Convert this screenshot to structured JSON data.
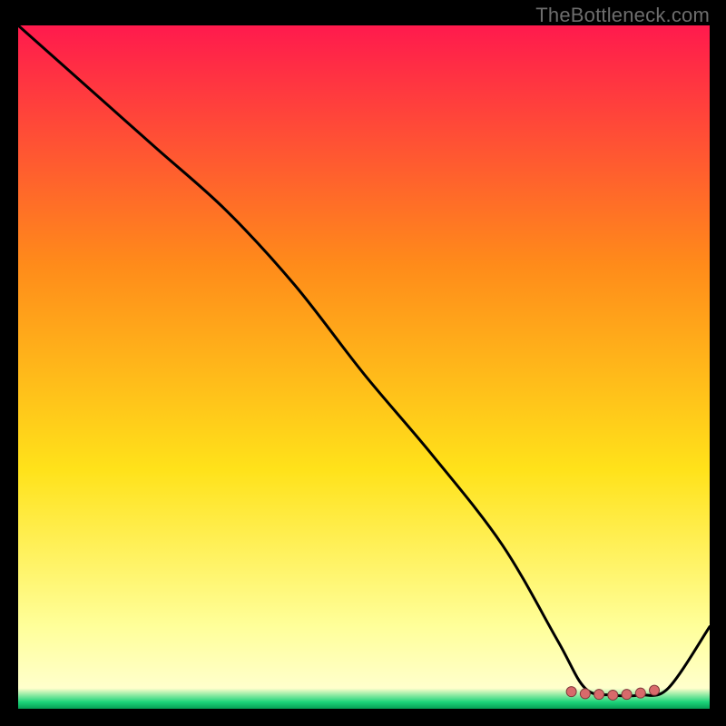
{
  "watermark": "TheBottleneck.com",
  "colors": {
    "bg": "#000000",
    "stroke": "#000000",
    "marker_fill": "#d86a6b",
    "marker_outline": "#803a3b",
    "grad_top": "#ff1a4d",
    "grad_mid1": "#ff8b1a",
    "grad_mid2": "#ffe21a",
    "grad_band": "#ffff9a",
    "grad_green": "#1cd47a"
  },
  "chart_data": {
    "type": "line",
    "title": "",
    "xlabel": "",
    "ylabel": "",
    "xlim": [
      0,
      100
    ],
    "ylim": [
      0,
      100
    ],
    "x": [
      0,
      10,
      20,
      30,
      40,
      50,
      60,
      70,
      78,
      82,
      86,
      90,
      94,
      100
    ],
    "y": [
      100,
      91,
      82,
      73,
      62,
      49,
      37,
      24,
      10,
      3,
      2,
      2,
      3,
      12
    ],
    "markers": {
      "x": [
        80,
        82,
        84,
        86,
        88,
        90,
        92
      ],
      "y": [
        2.5,
        2.2,
        2.1,
        2.0,
        2.1,
        2.3,
        2.7
      ]
    }
  }
}
